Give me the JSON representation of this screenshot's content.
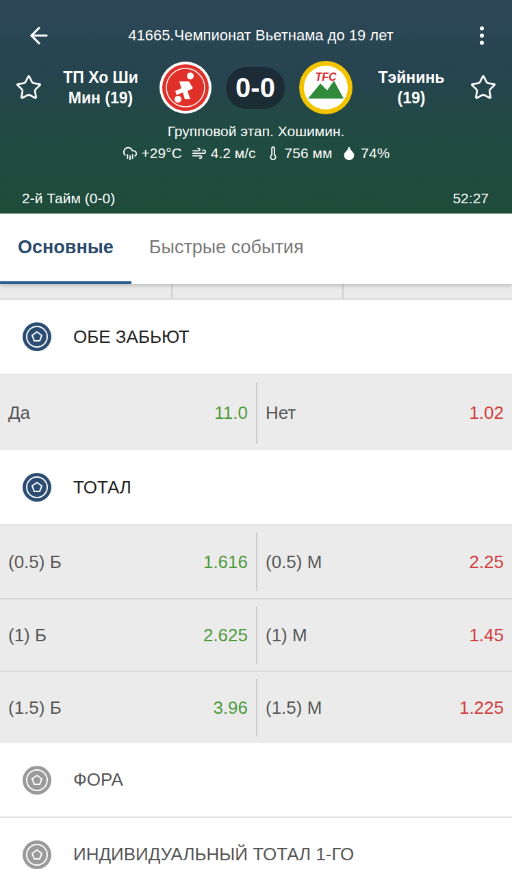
{
  "header": {
    "title": "41665.Чемпионат Вьетнама до 19 лет",
    "score": "0-0",
    "stage": "Групповой этап. Хошимин.",
    "period": "2-й Тайм (0-0)",
    "clock": "52:27",
    "teams": [
      {
        "name": "ТП Хо Ши Мин (19)",
        "favorite": false,
        "kind": "shield",
        "logo_text": ""
      },
      {
        "name": "Тэйнинь (19)",
        "favorite": false,
        "kind": "mountain",
        "logo_text": "TFC"
      }
    ],
    "weather": [
      {
        "kind": "rain",
        "text": "+29°C"
      },
      {
        "kind": "wind",
        "text": "4.2 м/с"
      },
      {
        "kind": "pressure",
        "text": "756 мм"
      },
      {
        "kind": "humidity",
        "text": "74%"
      }
    ]
  },
  "tabs": [
    {
      "label": "Основные",
      "selected": true
    },
    {
      "label": "Быстрые события",
      "selected": false
    }
  ],
  "markets": [
    {
      "title": "ОБЕ ЗАБЬЮТ",
      "expanded": true,
      "rows": [
        [
          {
            "label": "Да",
            "odds": "11.0",
            "color": "#4c9a3c"
          },
          {
            "label": "Нет",
            "odds": "1.02",
            "color": "#cf3d3d"
          }
        ]
      ]
    },
    {
      "title": "ТОТАЛ",
      "expanded": true,
      "rows": [
        [
          {
            "label": "(0.5) Б",
            "odds": "1.616",
            "color": "#4c9a3c"
          },
          {
            "label": "(0.5) М",
            "odds": "2.25",
            "color": "#cf3d3d"
          }
        ],
        [
          {
            "label": "(1) Б",
            "odds": "2.625",
            "color": "#4c9a3c"
          },
          {
            "label": "(1) М",
            "odds": "1.45",
            "color": "#cf3d3d"
          }
        ],
        [
          {
            "label": "(1.5) Б",
            "odds": "3.96",
            "color": "#4c9a3c"
          },
          {
            "label": "(1.5) М",
            "odds": "1.225",
            "color": "#cf3d3d"
          }
        ]
      ]
    },
    {
      "title": "ФОРА",
      "expanded": false,
      "rows": []
    },
    {
      "title": "ИНДИВИДУАЛЬНЫЙ ТОТАЛ 1-ГО",
      "expanded": false,
      "rows": []
    }
  ]
}
